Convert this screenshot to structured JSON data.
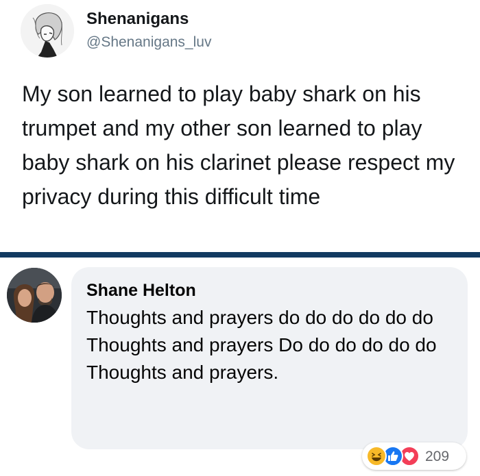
{
  "tweet": {
    "name": "Shenanigans",
    "handle": "@Shenanigans_luv",
    "text": "My son learned to play baby shark on his trumpet and my other son learned to play baby shark on his clarinet please respect my privacy during this difficult time",
    "avatar_icon": "sketch-portrait-avatar"
  },
  "comment": {
    "name": "Shane Helton",
    "lines": [
      "Thoughts and prayers do do do do do do",
      "Thoughts and prayers Do do do do do do",
      "Thoughts and prayers."
    ],
    "avatar_icon": "couple-selfie-avatar",
    "reactions": {
      "icons": [
        "haha-icon",
        "like-icon",
        "love-icon"
      ],
      "count": "209"
    }
  },
  "colors": {
    "divider": "#123a61",
    "bubble": "#f0f2f5",
    "like": "#1877f2",
    "love": "#f33e58",
    "haha": "#f7b928"
  }
}
